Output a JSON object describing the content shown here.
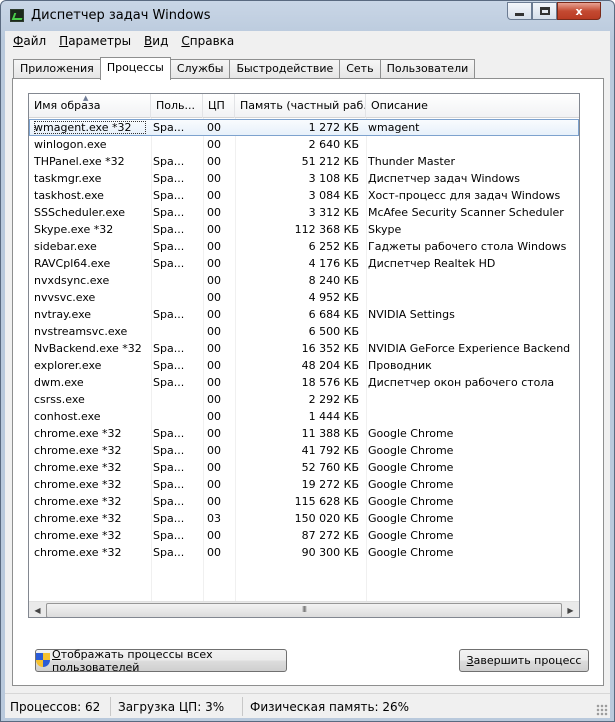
{
  "window": {
    "title": "Диспетчер задач Windows",
    "close_glyph": "x"
  },
  "menu": [
    {
      "label": "Файл",
      "hotkey": "Ф",
      "rest": "айл"
    },
    {
      "label": "Параметры",
      "hotkey": "П",
      "rest": "араметры"
    },
    {
      "label": "Вид",
      "hotkey": "В",
      "rest": "ид"
    },
    {
      "label": "Справка",
      "hotkey": "С",
      "rest": "правка"
    }
  ],
  "tabs": [
    "Приложения",
    "Процессы",
    "Службы",
    "Быстродействие",
    "Сеть",
    "Пользователи"
  ],
  "active_tab": "Процессы",
  "columns": [
    "Имя образа",
    "Поль...",
    "ЦП",
    "Память (частный раб...",
    "Описание"
  ],
  "processes": [
    {
      "name": "wmagent.exe *32",
      "user": "Spa...",
      "cpu": "00",
      "mem": "1 272 КБ",
      "desc": "wmagent",
      "selected": true
    },
    {
      "name": "winlogon.exe",
      "user": "",
      "cpu": "00",
      "mem": "2 640 КБ",
      "desc": ""
    },
    {
      "name": "THPanel.exe *32",
      "user": "Spa...",
      "cpu": "00",
      "mem": "51 212 КБ",
      "desc": "Thunder Master"
    },
    {
      "name": "taskmgr.exe",
      "user": "Spa...",
      "cpu": "00",
      "mem": "3 108 КБ",
      "desc": "Диспетчер задач Windows"
    },
    {
      "name": "taskhost.exe",
      "user": "Spa...",
      "cpu": "00",
      "mem": "3 084 КБ",
      "desc": "Хост-процесс для задач Windows"
    },
    {
      "name": "SSScheduler.exe",
      "user": "Spa...",
      "cpu": "00",
      "mem": "3 312 КБ",
      "desc": "McAfee Security Scanner Scheduler"
    },
    {
      "name": "Skype.exe *32",
      "user": "Spa...",
      "cpu": "00",
      "mem": "112 368 КБ",
      "desc": "Skype"
    },
    {
      "name": "sidebar.exe",
      "user": "Spa...",
      "cpu": "00",
      "mem": "6 252 КБ",
      "desc": "Гаджеты рабочего стола Windows"
    },
    {
      "name": "RAVCpl64.exe",
      "user": "Spa...",
      "cpu": "00",
      "mem": "4 176 КБ",
      "desc": "Диспетчер Realtek HD"
    },
    {
      "name": "nvxdsync.exe",
      "user": "",
      "cpu": "00",
      "mem": "8 240 КБ",
      "desc": ""
    },
    {
      "name": "nvvsvc.exe",
      "user": "",
      "cpu": "00",
      "mem": "4 952 КБ",
      "desc": ""
    },
    {
      "name": "nvtray.exe",
      "user": "Spa...",
      "cpu": "00",
      "mem": "6 684 КБ",
      "desc": "NVIDIA Settings"
    },
    {
      "name": "nvstreamsvc.exe",
      "user": "",
      "cpu": "00",
      "mem": "6 500 КБ",
      "desc": ""
    },
    {
      "name": "NvBackend.exe *32",
      "user": "Spa...",
      "cpu": "00",
      "mem": "16 352 КБ",
      "desc": "NVIDIA GeForce Experience Backend"
    },
    {
      "name": "explorer.exe",
      "user": "Spa...",
      "cpu": "00",
      "mem": "48 204 КБ",
      "desc": "Проводник"
    },
    {
      "name": "dwm.exe",
      "user": "Spa...",
      "cpu": "00",
      "mem": "18 576 КБ",
      "desc": "Диспетчер окон рабочего стола"
    },
    {
      "name": "csrss.exe",
      "user": "",
      "cpu": "00",
      "mem": "2 292 КБ",
      "desc": ""
    },
    {
      "name": "conhost.exe",
      "user": "",
      "cpu": "00",
      "mem": "1 444 КБ",
      "desc": ""
    },
    {
      "name": "chrome.exe *32",
      "user": "Spa...",
      "cpu": "00",
      "mem": "11 388 КБ",
      "desc": "Google Chrome"
    },
    {
      "name": "chrome.exe *32",
      "user": "Spa...",
      "cpu": "00",
      "mem": "41 792 КБ",
      "desc": "Google Chrome"
    },
    {
      "name": "chrome.exe *32",
      "user": "Spa...",
      "cpu": "00",
      "mem": "52 760 КБ",
      "desc": "Google Chrome"
    },
    {
      "name": "chrome.exe *32",
      "user": "Spa...",
      "cpu": "00",
      "mem": "19 272 КБ",
      "desc": "Google Chrome"
    },
    {
      "name": "chrome.exe *32",
      "user": "Spa...",
      "cpu": "00",
      "mem": "115 628 КБ",
      "desc": "Google Chrome"
    },
    {
      "name": "chrome.exe *32",
      "user": "Spa...",
      "cpu": "03",
      "mem": "150 020 КБ",
      "desc": "Google Chrome"
    },
    {
      "name": "chrome.exe *32",
      "user": "Spa...",
      "cpu": "00",
      "mem": "87 272 КБ",
      "desc": "Google Chrome"
    },
    {
      "name": "chrome.exe *32",
      "user": "Spa...",
      "cpu": "00",
      "mem": "90 300 КБ",
      "desc": "Google Chrome"
    }
  ],
  "scroll": {
    "left": "◀",
    "right": "▶",
    "thumb": "III"
  },
  "buttons": {
    "show_all": {
      "hotkey": "О",
      "rest": "тображать процессы всех пользователей"
    },
    "end_process": {
      "hotkey": "З",
      "rest": "авершить процесс"
    }
  },
  "status": {
    "processes": "Процессов: 62",
    "cpu": "Загрузка ЦП: 3%",
    "memory": "Физическая память: 26%"
  }
}
